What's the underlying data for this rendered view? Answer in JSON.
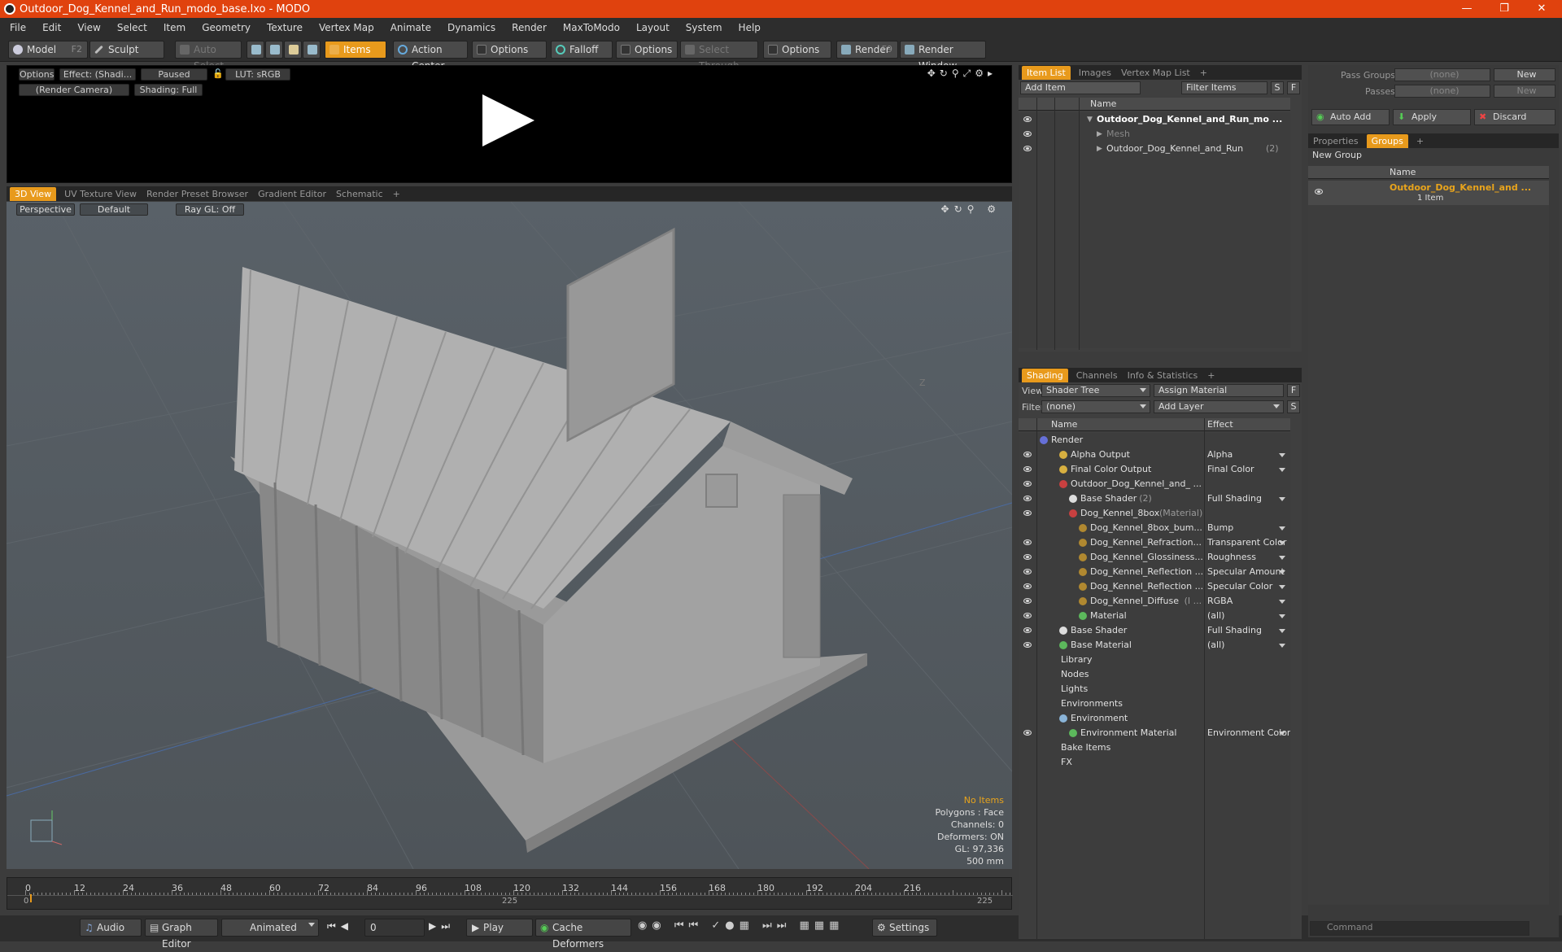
{
  "window": {
    "title": "Outdoor_Dog_Kennel_and_Run_modo_base.lxo - MODO"
  },
  "menu": [
    "File",
    "Edit",
    "View",
    "Select",
    "Item",
    "Geometry",
    "Texture",
    "Vertex Map",
    "Animate",
    "Dynamics",
    "Render",
    "MaxToModo",
    "Layout",
    "System",
    "Help"
  ],
  "toolbar": {
    "model": "Model",
    "model_key": "F2",
    "sculpt": "Sculpt",
    "auto_select": "Auto Select",
    "items": "Items",
    "action_center": "Action Center",
    "options1": "Options",
    "falloff": "Falloff",
    "options2": "Options",
    "select_through": "Select Through",
    "options3": "Options",
    "render": "Render",
    "render_key": "F9",
    "render_window": "Render Window"
  },
  "preview": {
    "options": "Options",
    "effect": "Effect: (Shadi...",
    "paused": "Paused",
    "lut": "LUT: sRGB",
    "camera": "(Render Camera)",
    "shading": "Shading: Full"
  },
  "view_tabs": [
    "3D View",
    "UV Texture View",
    "Render Preset Browser",
    "Gradient Editor",
    "Schematic"
  ],
  "viewport": {
    "perspective": "Perspective",
    "default": "Default",
    "raygl": "Ray GL: Off",
    "axis_z": "Z"
  },
  "hud": {
    "no_items": "No Items",
    "polygons": "Polygons : Face",
    "channels": "Channels: 0",
    "deformers": "Deformers: ON",
    "gl": "GL: 97,336",
    "scale": "500 mm"
  },
  "timeline": {
    "ticks": [
      "0",
      "12",
      "24",
      "36",
      "48",
      "60",
      "72",
      "84",
      "96",
      "108",
      "120",
      "132",
      "144",
      "156",
      "168",
      "180",
      "192",
      "204",
      "216"
    ],
    "start": "0",
    "mid": "225",
    "end": "225"
  },
  "bottombar": {
    "audio": "Audio",
    "graph_editor": "Graph Editor",
    "animated": "Animated",
    "frame": "0",
    "play": "Play",
    "cache": "Cache Deformers",
    "settings": "Settings"
  },
  "item_list": {
    "tabs": [
      "Item List",
      "Images",
      "Vertex Map List"
    ],
    "add_item": "Add Item",
    "filter": "Filter Items",
    "s": "S",
    "f": "F",
    "name_col": "Name",
    "items": [
      {
        "label": "Outdoor_Dog_Kennel_and_Run_mo ...",
        "indent": 0,
        "bold": true
      },
      {
        "label": "Mesh",
        "indent": 1,
        "bold": false,
        "dim": true
      },
      {
        "label": "Outdoor_Dog_Kennel_and_Run",
        "suffix": "(2)",
        "indent": 1,
        "bold": false
      }
    ]
  },
  "shading": {
    "tabs": [
      "Shading",
      "Channels",
      "Info & Statistics"
    ],
    "view_label": "View",
    "view_value": "Shader Tree",
    "assign": "Assign Material",
    "f": "F",
    "filter_label": "Filter",
    "filter_value": "(none)",
    "add_layer": "Add Layer",
    "s": "S",
    "name_col": "Name",
    "effect_col": "Effect",
    "rows": [
      {
        "name": "Render",
        "effect": "",
        "indent": 0,
        "color": "#6670d8",
        "eye": false
      },
      {
        "name": "Alpha Output",
        "effect": "Alpha",
        "indent": 2,
        "color": "#d8b040",
        "eye": true
      },
      {
        "name": "Final Color Output",
        "effect": "Final Color",
        "indent": 2,
        "color": "#d8b040",
        "eye": true
      },
      {
        "name": "Outdoor_Dog_Kennel_and_ ...",
        "effect": "",
        "indent": 2,
        "color": "#c84040",
        "eye": true
      },
      {
        "name": "Base Shader",
        "suffix": "(2)",
        "effect": "Full Shading",
        "indent": 3,
        "color": "#dddddd",
        "eye": true
      },
      {
        "name": "Dog_Kennel_8box",
        "suffix": "(Material)",
        "effect": "",
        "indent": 3,
        "color": "#c84040",
        "eye": true
      },
      {
        "name": "Dog_Kennel_8box_bum...",
        "effect": "Bump",
        "indent": 4,
        "color": "#b08830",
        "eye": false
      },
      {
        "name": "Dog_Kennel_Refraction...",
        "effect": "Transparent Color",
        "indent": 4,
        "color": "#b08830",
        "eye": true
      },
      {
        "name": "Dog_Kennel_Glossiness...",
        "effect": "Roughness",
        "indent": 4,
        "color": "#b08830",
        "eye": true
      },
      {
        "name": "Dog_Kennel_Reflection ...",
        "effect": "Specular Amount",
        "indent": 4,
        "color": "#b08830",
        "eye": true
      },
      {
        "name": "Dog_Kennel_Reflection ...",
        "effect": "Specular Color",
        "indent": 4,
        "color": "#b08830",
        "eye": true
      },
      {
        "name": "Dog_Kennel_Diffuse",
        "suffix": "(I ...",
        "effect": "RGBA",
        "indent": 4,
        "color": "#b08830",
        "eye": true
      },
      {
        "name": "Material",
        "effect": "(all)",
        "indent": 4,
        "color": "#5cb85c",
        "eye": true
      },
      {
        "name": "Base Shader",
        "effect": "Full Shading",
        "indent": 2,
        "color": "#dddddd",
        "eye": true
      },
      {
        "name": "Base Material",
        "effect": "(all)",
        "indent": 2,
        "color": "#5cb85c",
        "eye": true
      },
      {
        "name": "Library",
        "effect": "",
        "indent": 1,
        "color": "",
        "eye": false
      },
      {
        "name": "Nodes",
        "effect": "",
        "indent": 1,
        "color": "",
        "eye": false
      },
      {
        "name": "Lights",
        "effect": "",
        "indent": 1,
        "color": "",
        "eye": false
      },
      {
        "name": "Environments",
        "effect": "",
        "indent": 1,
        "color": "",
        "eye": false
      },
      {
        "name": "Environment",
        "effect": "",
        "indent": 2,
        "color": "#8ab4d8",
        "eye": false
      },
      {
        "name": "Environment Material",
        "effect": "Environment Color",
        "indent": 3,
        "color": "#5cb85c",
        "eye": true
      },
      {
        "name": "Bake Items",
        "effect": "",
        "indent": 1,
        "color": "",
        "eye": false
      },
      {
        "name": "FX",
        "effect": "",
        "indent": 1,
        "color": "",
        "eye": false
      }
    ]
  },
  "right": {
    "pass_groups": "Pass Groups",
    "pass_groups_val": "(none)",
    "new1": "New",
    "passes": "Passes",
    "passes_val": "(none)",
    "new2": "New",
    "auto_add": "Auto Add",
    "apply": "Apply",
    "discard": "Discard",
    "tabs": [
      "Properties",
      "Groups"
    ],
    "new_group": "New Group",
    "name_col": "Name",
    "group_name": "Outdoor_Dog_Kennel_and ...",
    "group_count": "1 Item",
    "command": "Command"
  }
}
